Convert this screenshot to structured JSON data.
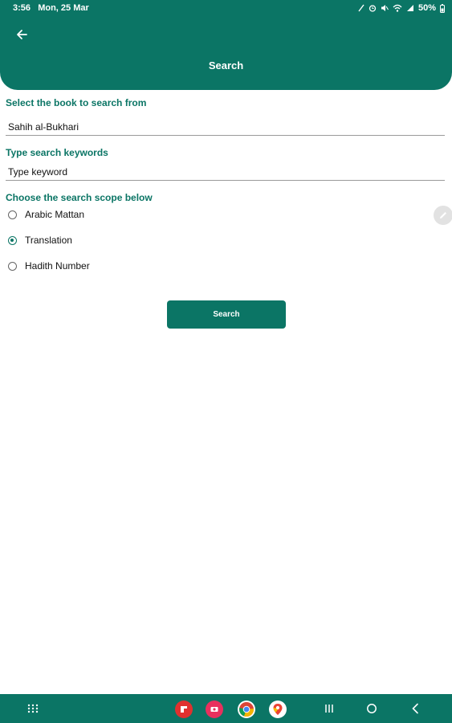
{
  "status_bar": {
    "time": "3:56",
    "date": "Mon, 25 Mar",
    "battery": "50%",
    "icons": [
      "nfc-icon",
      "alarm-icon",
      "mute-icon",
      "wifi-icon",
      "signal-icon",
      "battery-icon"
    ]
  },
  "header": {
    "title": "Search",
    "back_icon": "arrow-left-icon"
  },
  "form": {
    "book_label": "Select the book to search from",
    "book_value": "Sahih al-Bukhari",
    "keyword_label": "Type search keywords",
    "keyword_placeholder": "Type keyword",
    "scope_label": "Choose the search scope below",
    "scope_options": [
      {
        "label": "Arabic Mattan",
        "selected": false
      },
      {
        "label": "Translation",
        "selected": true
      },
      {
        "label": "Hadith Number",
        "selected": false
      }
    ],
    "search_button": "Search"
  },
  "floating": {
    "edit_icon": "pencil-icon"
  },
  "nav_bar": {
    "apps_icon": "app-drawer-icon",
    "apps": [
      "flipboard-icon",
      "screen-recorder-icon",
      "chrome-icon",
      "maps-icon"
    ],
    "buttons": [
      "recents-icon",
      "home-icon",
      "back-icon"
    ]
  },
  "colors": {
    "primary": "#0b7565",
    "background": "#ffffff",
    "text": "#111111"
  }
}
